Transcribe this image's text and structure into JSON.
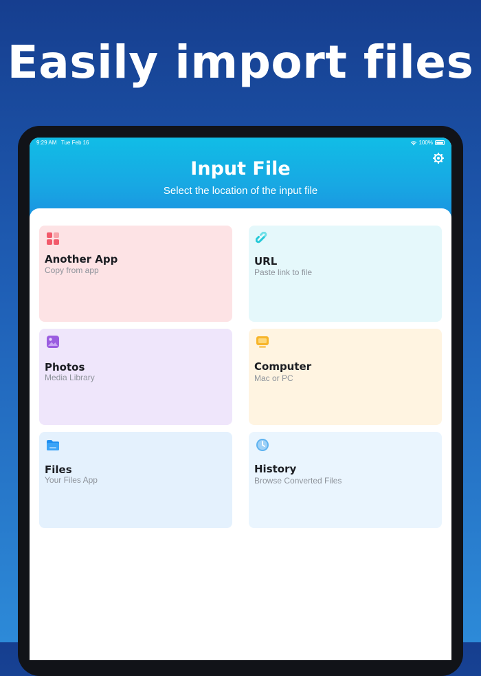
{
  "headline": "Easily import files",
  "status": {
    "time": "9:29 AM",
    "date": "Tue Feb 16",
    "battery": "100%"
  },
  "header": {
    "title": "Input File",
    "subtitle": "Select the location of the input file"
  },
  "cards": [
    {
      "name": "Another App",
      "desc": "Copy from app",
      "bg": "#fde3e5",
      "icon": "apps-grid-icon"
    },
    {
      "name": "URL",
      "desc": "Paste link to file",
      "bg": "#e5f8fb",
      "icon": "link-icon"
    },
    {
      "name": "Photos",
      "desc": "Media Library",
      "bg": "#efe6fb",
      "icon": "photo-icon"
    },
    {
      "name": "Computer",
      "desc": "Mac or PC",
      "bg": "#fff4e1",
      "icon": "monitor-icon"
    },
    {
      "name": "Files",
      "desc": "Your Files App",
      "bg": "#e4f1fd",
      "icon": "folder-icon"
    },
    {
      "name": "History",
      "desc": "Browse Converted Files",
      "bg": "#eaf5fe",
      "icon": "clock-icon"
    }
  ]
}
